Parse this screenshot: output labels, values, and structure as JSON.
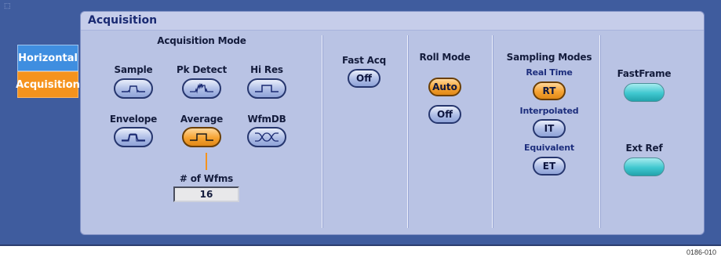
{
  "sidebar": {
    "tabs": [
      {
        "label": "Horizontal",
        "active": false
      },
      {
        "label": "Acquisition",
        "active": true
      }
    ]
  },
  "panel": {
    "title": "Acquisition"
  },
  "acquisition_mode": {
    "heading": "Acquisition Mode",
    "buttons": [
      {
        "label": "Sample",
        "icon": "sample-waveform-icon",
        "active": false
      },
      {
        "label": "Pk Detect",
        "icon": "peak-detect-waveform-icon",
        "active": false
      },
      {
        "label": "Hi Res",
        "icon": "hi-res-waveform-icon",
        "active": false
      },
      {
        "label": "Envelope",
        "icon": "envelope-waveform-icon",
        "active": false
      },
      {
        "label": "Average",
        "icon": "average-waveform-icon",
        "active": true
      },
      {
        "label": "WfmDB",
        "icon": "wfmdb-waveform-icon",
        "active": false
      }
    ],
    "wfms_label": "# of Wfms",
    "wfms_value": "16"
  },
  "fast_acq": {
    "heading": "Fast Acq",
    "button": "Off"
  },
  "roll_mode": {
    "heading": "Roll Mode",
    "auto": "Auto",
    "off": "Off",
    "selected": "Auto"
  },
  "sampling_modes": {
    "heading": "Sampling Modes",
    "real_time_label": "Real Time",
    "real_time_button": "RT",
    "interpolated_label": "Interpolated",
    "interpolated_button": "IT",
    "equivalent_label": "Equivalent",
    "equivalent_button": "ET",
    "selected": "RT"
  },
  "fastframe": {
    "label": "FastFrame"
  },
  "ext_ref": {
    "label": "Ext Ref"
  },
  "figure_id": "0186-010",
  "colors": {
    "window_bg": "#3f5c9e",
    "panel_bg": "#b9c3e4",
    "active_orange": "#f5931d",
    "tab_blue": "#3f8ee0",
    "teal": "#3fc7cf",
    "title_text": "#1a2a72"
  }
}
